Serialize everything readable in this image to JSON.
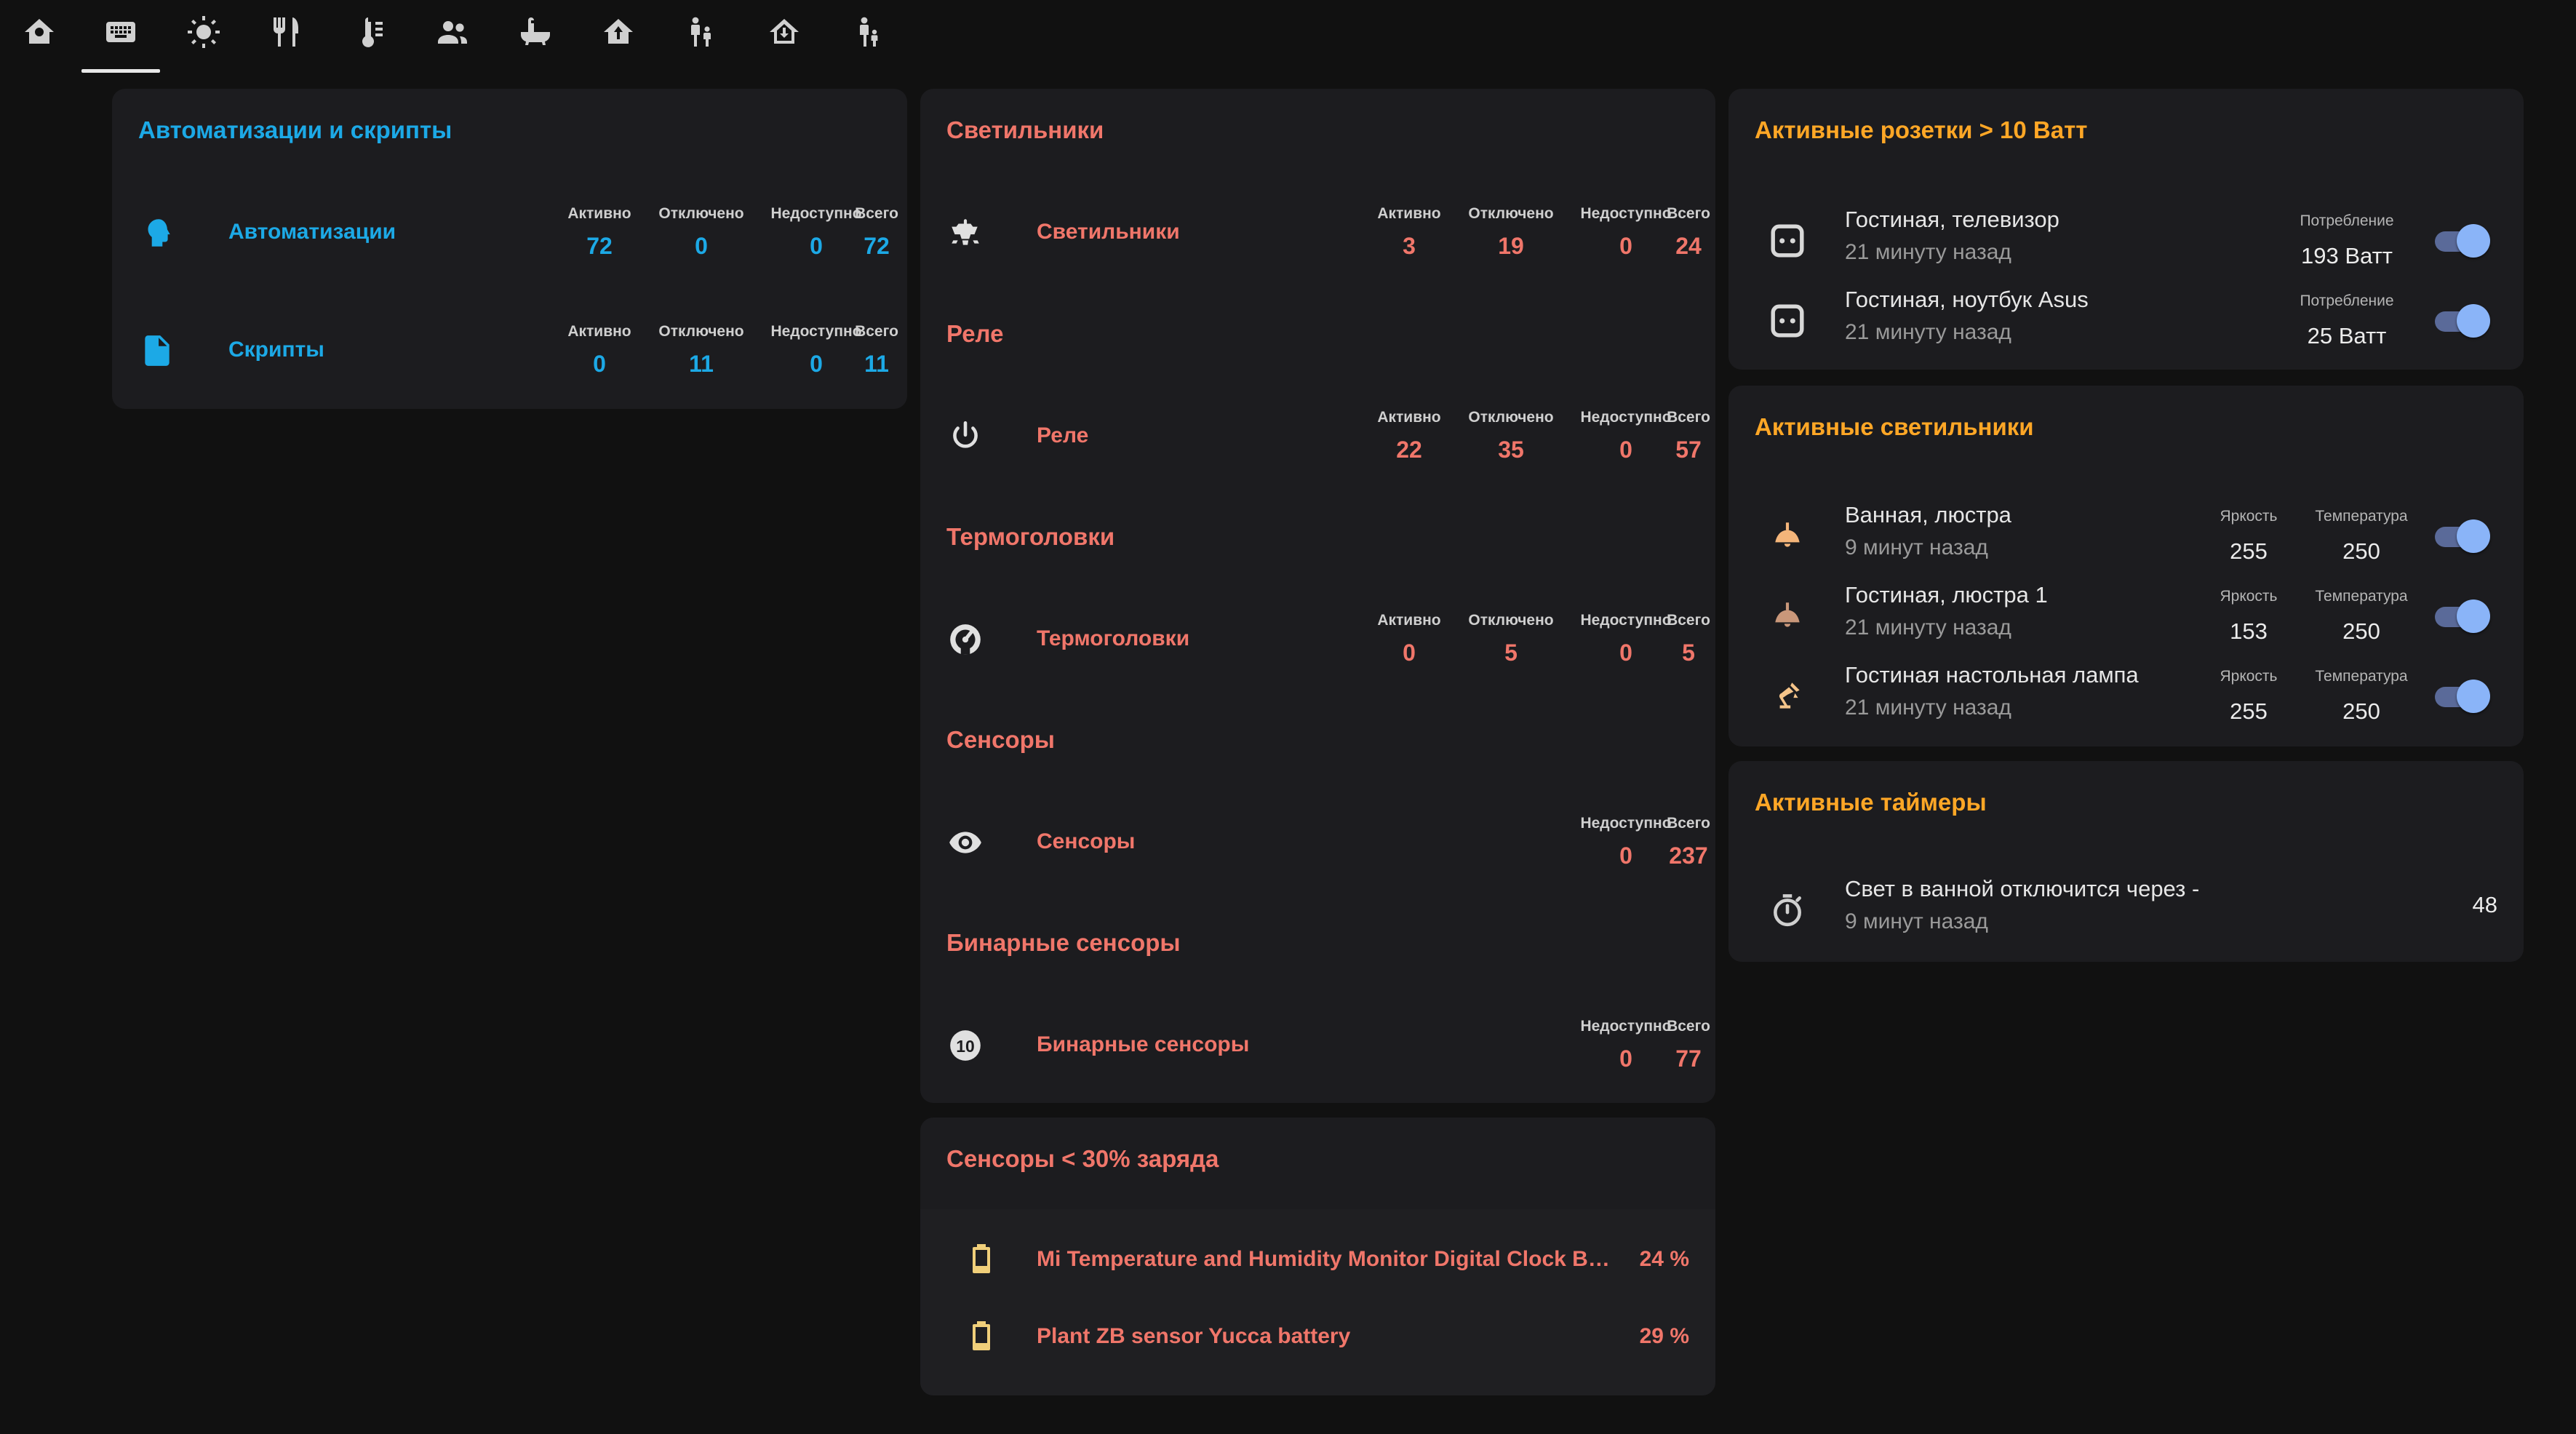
{
  "nav": {
    "tabs": [
      {
        "icon": "home-icon"
      },
      {
        "icon": "keyboard-icon"
      },
      {
        "icon": "sun-lamp-icon"
      },
      {
        "icon": "silverware-icon"
      },
      {
        "icon": "thermometer-icon"
      },
      {
        "icon": "people-icon"
      },
      {
        "icon": "bathtub-icon"
      },
      {
        "icon": "home-floor-icon"
      },
      {
        "icon": "parent-child-icon"
      },
      {
        "icon": "home-import-icon"
      },
      {
        "icon": "child-icon"
      }
    ],
    "active_index": 1
  },
  "colors": {
    "blue": "#1ca9e6",
    "red": "#f0766a",
    "orange": "#ffa726",
    "card": "#1c1c1f",
    "background": "#111111"
  },
  "automations_card": {
    "title": "Автоматизации и скрипты",
    "rows": [
      {
        "name": "Автоматизации",
        "icon": "robot-head-icon",
        "stats": [
          {
            "label": "Активно",
            "value": "72"
          },
          {
            "label": "Отключено",
            "value": "0"
          },
          {
            "label": "Недоступно",
            "value": "0"
          },
          {
            "label": "Всего",
            "value": "72"
          }
        ]
      },
      {
        "name": "Скрипты",
        "icon": "file-document-icon",
        "stats": [
          {
            "label": "Активно",
            "value": "0"
          },
          {
            "label": "Отключено",
            "value": "11"
          },
          {
            "label": "Недоступно",
            "value": "0"
          },
          {
            "label": "Всего",
            "value": "11"
          }
        ]
      }
    ]
  },
  "devices_card": {
    "sections": [
      {
        "title": "Светильники",
        "name": "Светильники",
        "icon": "ceiling-lamp-icon",
        "stats": [
          {
            "label": "Активно",
            "value": "3"
          },
          {
            "label": "Отключено",
            "value": "19"
          },
          {
            "label": "Недоступно",
            "value": "0"
          },
          {
            "label": "Всего",
            "value": "24"
          }
        ]
      },
      {
        "title": "Реле",
        "name": "Реле",
        "icon": "power-icon",
        "stats": [
          {
            "label": "Активно",
            "value": "22"
          },
          {
            "label": "Отключено",
            "value": "35"
          },
          {
            "label": "Недоступно",
            "value": "0"
          },
          {
            "label": "Всего",
            "value": "57"
          }
        ]
      },
      {
        "title": "Термоголовки",
        "name": "Термоголовки",
        "icon": "gauge-icon",
        "stats": [
          {
            "label": "Активно",
            "value": "0"
          },
          {
            "label": "Отключено",
            "value": "5"
          },
          {
            "label": "Недоступно",
            "value": "0"
          },
          {
            "label": "Всего",
            "value": "5"
          }
        ]
      },
      {
        "title": "Сенсоры",
        "name": "Сенсоры",
        "icon": "eye-icon",
        "stats": [
          {
            "label": "Недоступно",
            "value": "0"
          },
          {
            "label": "Всего",
            "value": "237"
          }
        ]
      },
      {
        "title": "Бинарные сенсоры",
        "name": "Бинарные сенсоры",
        "icon": "numeric-10-circle-icon",
        "stats": [
          {
            "label": "Недоступно",
            "value": "0"
          },
          {
            "label": "Всего",
            "value": "77"
          }
        ]
      }
    ]
  },
  "battery_card": {
    "title": "Сенсоры < 30% заряда",
    "rows": [
      {
        "name": "Mi Temperature and Humidity Monitor Digital Clock Batt...",
        "value": "24 %",
        "icon": "battery-low-icon"
      },
      {
        "name": "Plant ZB sensor Yucca battery",
        "value": "29 %",
        "icon": "battery-low-icon"
      }
    ]
  },
  "sockets_card": {
    "title": "Активные розетки > 10 Ватт",
    "rows": [
      {
        "name": "Гостиная, телевизор",
        "time": "21 минуту назад",
        "attr_label": "Потребление",
        "attr_value": "193 Ватт",
        "icon": "power-socket-icon",
        "on": true
      },
      {
        "name": "Гостиная, ноутбук Asus",
        "time": "21 минуту назад",
        "attr_label": "Потребление",
        "attr_value": "25 Ватт",
        "icon": "power-socket-icon",
        "on": true
      }
    ]
  },
  "lights_card": {
    "title": "Активные светильники",
    "rows": [
      {
        "name": "Ванная, люстра",
        "time": "9 минут назад",
        "brightness_label": "Яркость",
        "brightness": "255",
        "temp_label": "Температура",
        "temp": "250",
        "icon": "ceiling-light-icon",
        "on": true
      },
      {
        "name": "Гостиная, люстра 1",
        "time": "21 минуту назад",
        "brightness_label": "Яркость",
        "brightness": "153",
        "temp_label": "Температура",
        "temp": "250",
        "icon": "ceiling-light-icon",
        "on": true
      },
      {
        "name": "Гостиная настольная лампа",
        "time": "21 минуту назад",
        "brightness_label": "Яркость",
        "brightness": "255",
        "temp_label": "Температура",
        "temp": "250",
        "icon": "desk-lamp-icon",
        "on": true
      }
    ]
  },
  "timers_card": {
    "title": "Активные таймеры",
    "rows": [
      {
        "name": "Свет в ванной отключится через -",
        "time": "9 минут назад",
        "value": "48",
        "icon": "timer-icon"
      }
    ]
  }
}
